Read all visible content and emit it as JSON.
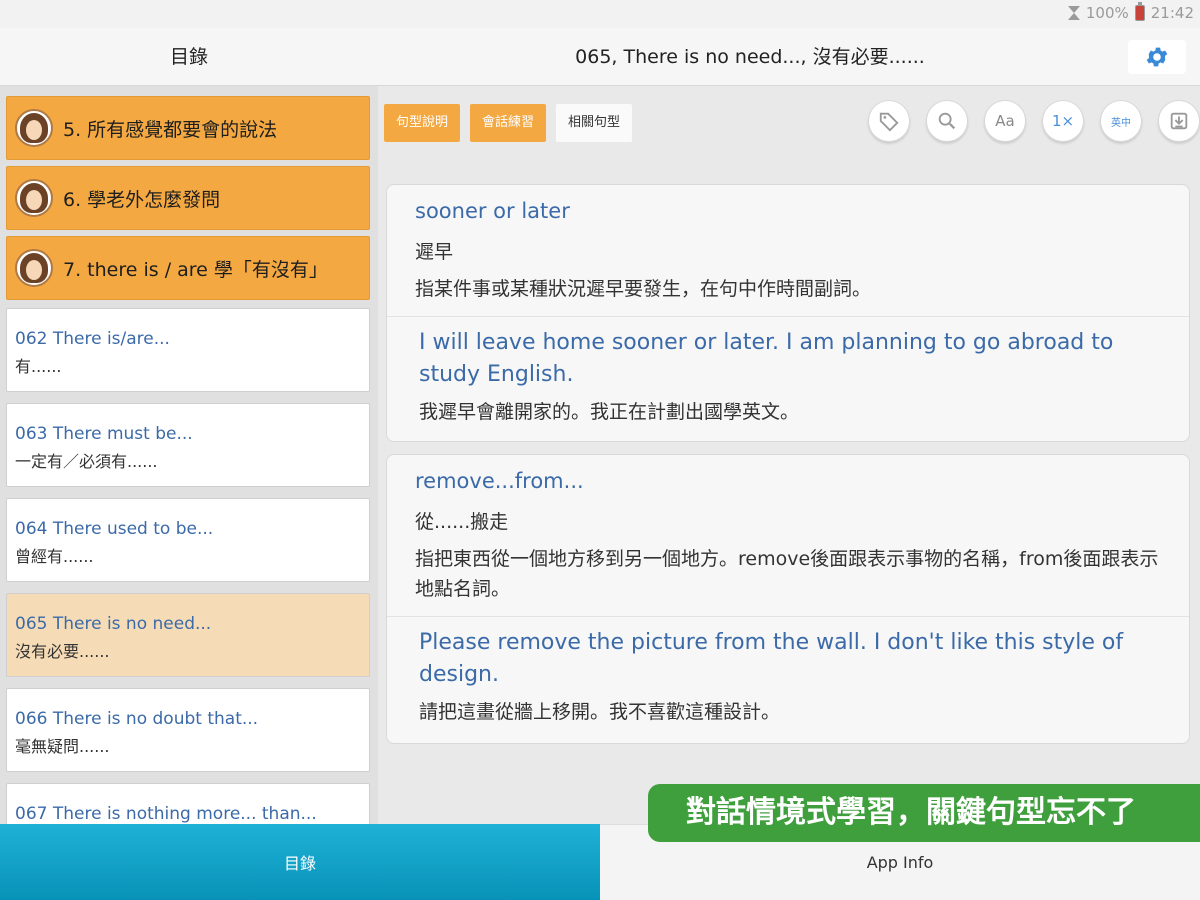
{
  "status": {
    "battery": "100%",
    "time": "21:42"
  },
  "header": {
    "sidebar_title": "目錄",
    "title": "065, There is no need..., 沒有必要......"
  },
  "sidebar": {
    "categories": [
      {
        "label": "5. 所有感覺都要會的說法"
      },
      {
        "label": "6. 學老外怎麼發問"
      },
      {
        "label": "7. there is / are 學「有沒有」"
      }
    ],
    "patterns": [
      {
        "en": "062  There is/are...",
        "zh": "有......"
      },
      {
        "en": "063  There must be...",
        "zh": "一定有／必須有......"
      },
      {
        "en": "064  There used to be...",
        "zh": "曾經有......"
      },
      {
        "en": "065  There is no need...",
        "zh": "沒有必要......"
      },
      {
        "en": "066  There is no doubt that...",
        "zh": "毫無疑問......"
      },
      {
        "en": "067  There is nothing more... than...",
        "zh": ""
      }
    ]
  },
  "tabs": [
    {
      "label": "句型說明"
    },
    {
      "label": "會話練習"
    },
    {
      "label": "相關句型"
    }
  ],
  "tools": [
    {
      "icon": "tag-icon",
      "label": ""
    },
    {
      "icon": "search-icon",
      "label": ""
    },
    {
      "icon": "font-size-icon",
      "label": "Aa"
    },
    {
      "icon": "speed-icon",
      "label": "1×"
    },
    {
      "icon": "translate-icon",
      "label": "英中"
    },
    {
      "icon": "download-icon",
      "label": ""
    }
  ],
  "cards": [
    {
      "term": "sooner or later",
      "term_zh": "遲早",
      "definition": "指某件事或某種狀況遲早要發生，在句中作時間副詞。",
      "example_en": "I will leave home sooner or later. I am planning to go abroad to study English.",
      "example_zh": "我遲早會離開家的。我正在計劃出國學英文。"
    },
    {
      "term": "remove...from...",
      "term_zh": "從......搬走",
      "definition": "指把東西從一個地方移到另一個地方。remove後面跟表示事物的名稱，from後面跟表示地點名詞。",
      "example_en": "Please remove the picture from the wall. I don't like this style of design.",
      "example_zh": "請把這畫從牆上移開。我不喜歡這種設計。"
    }
  ],
  "promo": "對話情境式學習，關鍵句型忘不了",
  "bottom_nav": {
    "catalog": "目錄",
    "app_info": "App Info"
  },
  "colors": {
    "orange": "#f4a842",
    "blue_text": "#3b6aa8",
    "nav_blue": "#1fb2d6",
    "promo_green": "#3e9f3c"
  }
}
